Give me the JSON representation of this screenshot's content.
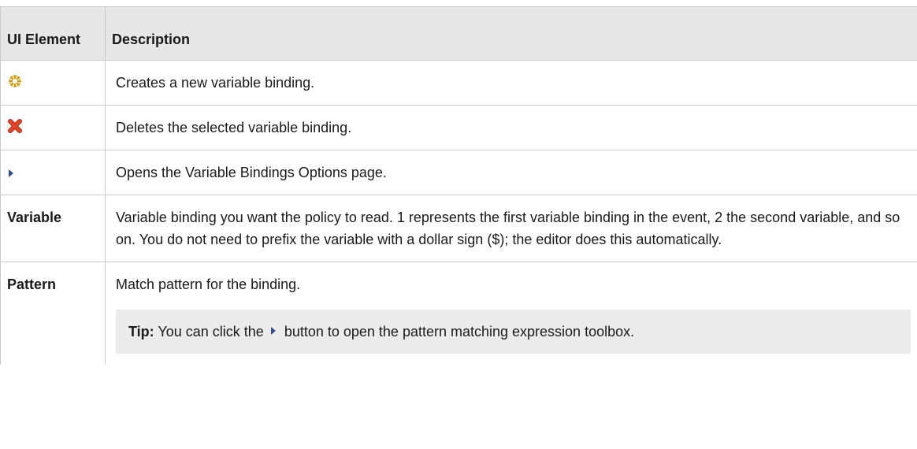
{
  "table": {
    "headers": {
      "ui_element": "UI Element",
      "description": "Description"
    },
    "rows": [
      {
        "icon": "new-binding-icon",
        "description": "Creates a new variable binding."
      },
      {
        "icon": "delete-binding-icon",
        "description": "Deletes the selected variable binding."
      },
      {
        "icon": "expand-triangle-icon",
        "description": "Opens the Variable Bindings Options page."
      },
      {
        "name": "Variable",
        "description": "Variable binding you want the policy to read. 1 represents the first variable binding in the event, 2 the second variable, and so on. You do not need to prefix the variable with a dollar sign ($); the editor does this automatically."
      },
      {
        "name": "Pattern",
        "description": "Match pattern for the binding."
      }
    ],
    "tip": {
      "label": "Tip:",
      "text_before": "You can click the",
      "text_after": "button to open the pattern matching expression toolbox."
    }
  },
  "colors": {
    "header_bg": "#e6e6e6",
    "tip_bg": "#ebebeb",
    "border": "#c9c9c9",
    "triangle": "#2f4f8f",
    "delete_icon": "#e0452b",
    "new_icon": "#f2c83b"
  }
}
